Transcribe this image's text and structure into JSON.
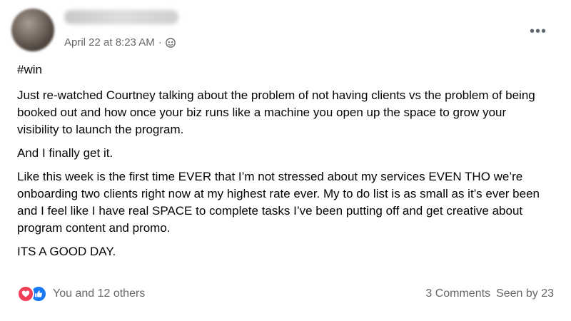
{
  "post": {
    "timestamp": "April 22 at 8:23 AM",
    "separator": "·",
    "audience_icon": "friends-icon",
    "more_icon": "more-options-icon",
    "body": {
      "hashtag": "#win",
      "paragraphs": [
        "Just re-watched Courtney talking about the problem of not having clients vs the problem of being booked out and how once your biz runs like a machine you open up the space to grow your visibility to launch the program.",
        "And I finally get it.",
        "Like this week is the first time EVER that I’m not stressed about my services EVEN THO we’re onboarding two clients right now at my highest rate ever. My to do list is as small as it’s ever been and I feel like I have real SPACE to complete tasks I’ve been putting off and get creative about program content and promo.",
        "ITS A GOOD DAY."
      ]
    }
  },
  "footer": {
    "reaction_icons": [
      "love-reaction-icon",
      "like-reaction-icon"
    ],
    "reactions_summary": "You and 12 others",
    "comments": "3 Comments",
    "seen_by": "Seen by 23"
  },
  "colors": {
    "love": "#f33e58",
    "like": "#1877f2",
    "secondary_text": "#65676b"
  }
}
